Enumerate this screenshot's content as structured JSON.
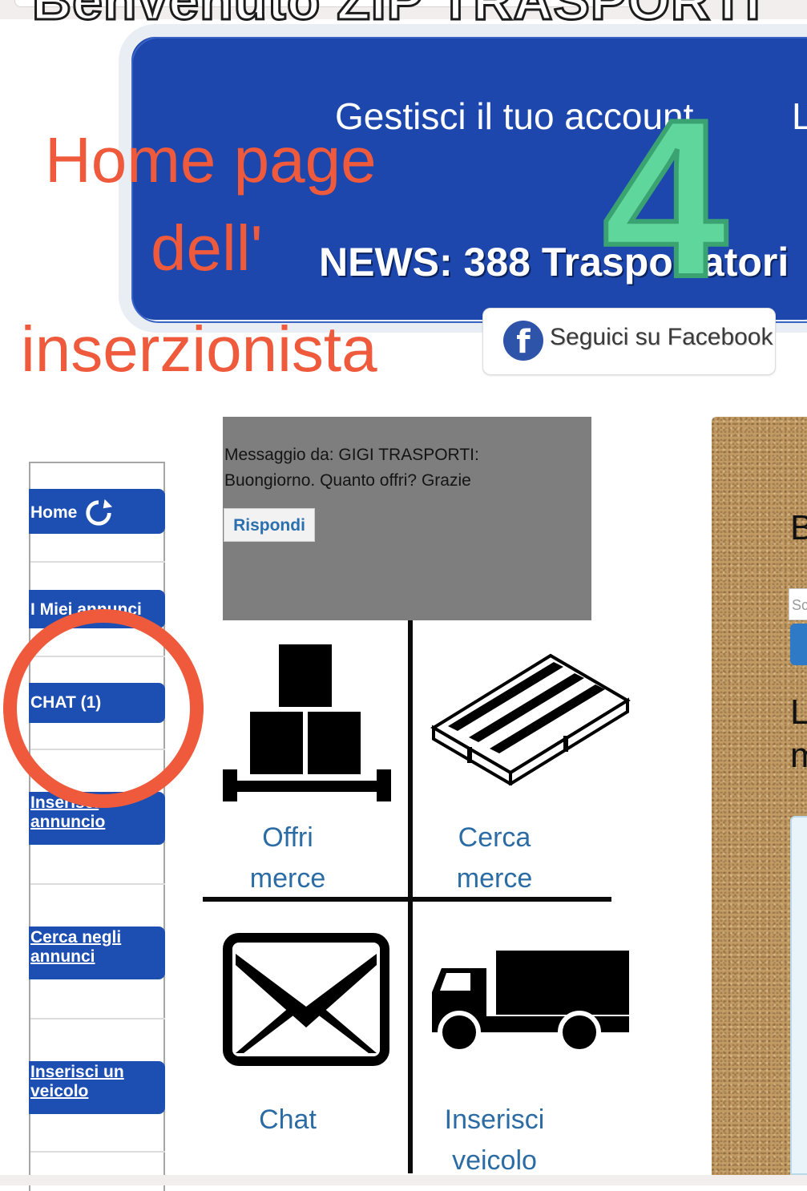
{
  "header": {
    "welcome_text": "Benvenuto ZIP TRASPORTI",
    "account_link": "Gestisci il tuo account",
    "account_link_2": "L",
    "news": "NEWS: 388 Trasportatori"
  },
  "annotation": {
    "line1": "Home page",
    "line2": "dell'",
    "line3": "inserzionista",
    "step_number": "4",
    "circle_color": "#ef5a3c"
  },
  "facebook": {
    "label": "Seguici su Facebook",
    "icon": "f"
  },
  "sidebar": {
    "items": [
      {
        "label": "Home",
        "icon": "refresh-icon"
      },
      {
        "label": "I Miei annunci"
      },
      {
        "label": "CHAT (1)"
      },
      {
        "label_a": "Inserisci",
        "label_b": "annuncio"
      },
      {
        "label_a": "Cerca negli",
        "label_b": "annunci"
      },
      {
        "label_a": "Inserisci un",
        "label_b": "veicolo"
      }
    ]
  },
  "message": {
    "line1": "Messaggio da: GIGI TRASPORTI:",
    "line2": "Buongiorno. Quanto offri? Grazie",
    "reply_label": "Rispondi"
  },
  "tiles": [
    {
      "line1": "Offri",
      "line2": "merce",
      "icon": "boxes-icon"
    },
    {
      "line1": "Cerca",
      "line2": "merce",
      "icon": "pallet-icon"
    },
    {
      "line1": "Chat",
      "line2": "",
      "icon": "envelope-icon"
    },
    {
      "line1": "Inserisci",
      "line2": "veicolo",
      "icon": "truck-icon"
    }
  ],
  "cork": {
    "text_top": "B",
    "input_placeholder": "Sc",
    "text_mid_1": "L",
    "text_mid_2": "m"
  },
  "colors": {
    "nav_blue": "#1d4fb3",
    "banner_blue": "#1d47ad",
    "accent_green": "#5fd69b",
    "tile_label": "#2c6ca4"
  }
}
